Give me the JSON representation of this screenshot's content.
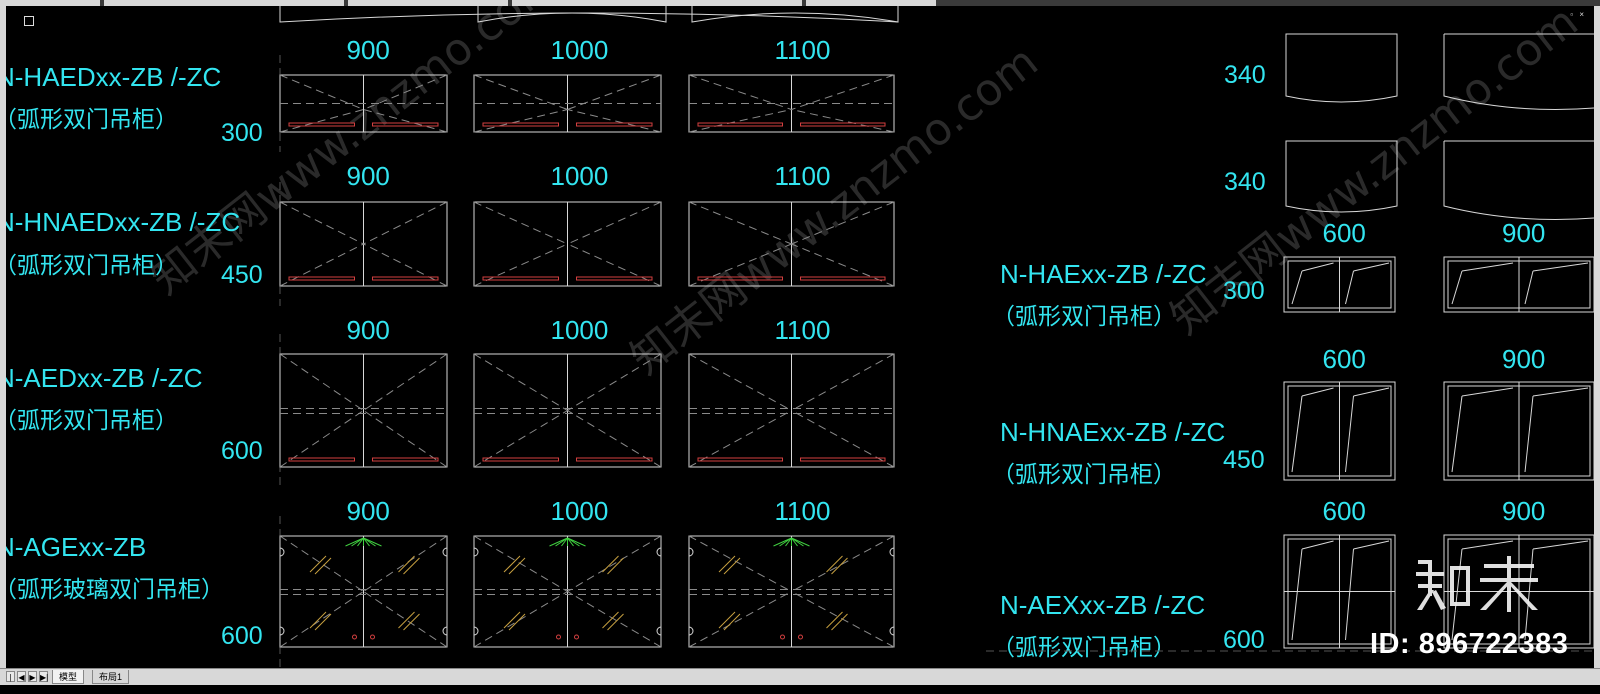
{
  "status_bar": {
    "nav_buttons": [
      "|◀",
      "◀",
      "▶",
      "▶|"
    ],
    "tabs": [
      {
        "label": "模型",
        "active": true
      },
      {
        "label": "布局1",
        "active": false
      }
    ]
  },
  "window_controls": "– ▫ ×",
  "colors": {
    "label": "#33e5f0",
    "line": "#d8d8d8",
    "dash": "#8a8a8a",
    "hinge": "#d44040",
    "glass": "#c8a040",
    "light": "#40d040"
  },
  "left_group": {
    "rows": [
      {
        "code": "N-HAEDxx-ZB  /-ZC",
        "desc": "（弧形双门吊柜）",
        "height": "300",
        "widths": [
          "900",
          "1000",
          "1100"
        ]
      },
      {
        "code": "N-HNAEDxx-ZB  /-ZC",
        "desc": "（弧形双门吊柜）",
        "height": "450",
        "widths": [
          "900",
          "1000",
          "1100"
        ]
      },
      {
        "code": "N-AEDxx-ZB  /-ZC",
        "desc": "（弧形双门吊柜）",
        "height": "600",
        "widths": [
          "900",
          "1000",
          "1100"
        ]
      },
      {
        "code": "N-AGExx-ZB",
        "desc": "（弧形玻璃双门吊柜）",
        "height": "600",
        "widths": [
          "900",
          "1000",
          "1100"
        ]
      }
    ]
  },
  "right_group": {
    "plan_heights": [
      "340",
      "340"
    ],
    "rows": [
      {
        "code": "N-HAExx-ZB  /-ZC",
        "desc": "（弧形双门吊柜）",
        "height": "300",
        "widths": [
          "600",
          "900"
        ]
      },
      {
        "code": "N-HNAExx-ZB  /-ZC",
        "desc": "（弧形双门吊柜）",
        "height": "450",
        "widths": [
          "600",
          "900"
        ]
      },
      {
        "code": "N-AEXxx-ZB  /-ZC",
        "desc": "（弧形双门吊柜）",
        "height": "600",
        "widths": [
          "600",
          "900"
        ]
      }
    ]
  },
  "watermark": {
    "text": "知末网www.znzmo.com",
    "logo": "知末",
    "id_label": "ID: 896722383"
  }
}
